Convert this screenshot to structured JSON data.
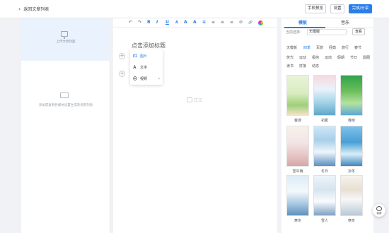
{
  "header": {
    "back_label": "返回文章列表",
    "buttons": [
      "手机预览",
      "设置",
      "完成/分享"
    ]
  },
  "left_panel": {
    "cover_text": "上传文章封面",
    "empty_text": "添加或复制各媒体设置生成的场景列表"
  },
  "editor": {
    "toolbar": [
      "↶",
      "↷",
      "B",
      "I",
      "U",
      "A",
      "A",
      "A",
      "≡",
      "≡",
      "≡",
      "≡",
      "⊘",
      "🔗"
    ],
    "title_placeholder": "点击添加标题",
    "insert_menu": [
      "图片",
      "文字",
      "视频"
    ],
    "body_placeholder": "正文"
  },
  "right_panel": {
    "tabs": [
      "模板",
      "音乐"
    ],
    "current_label": "当前选择：",
    "current_value": "无模版",
    "view_button": "查看",
    "categories": [
      "无模板",
      "四季",
      "军旅",
      "经典",
      "旅行",
      "春节",
      "荧光",
      "运动",
      "极简",
      "运动",
      "假期",
      "节日",
      "圆圈",
      "读书",
      "拼接",
      "动态"
    ],
    "active_category": "四季",
    "templates": [
      "春游",
      "初夏",
      "春晓",
      "雪中梅",
      "冬日",
      "凉冬",
      "寒冬",
      "雪人",
      "寒冬"
    ]
  },
  "customer_service": "客服",
  "colors": {
    "accent": "#2b7de9",
    "cover_bg": "#e9f2fd"
  }
}
